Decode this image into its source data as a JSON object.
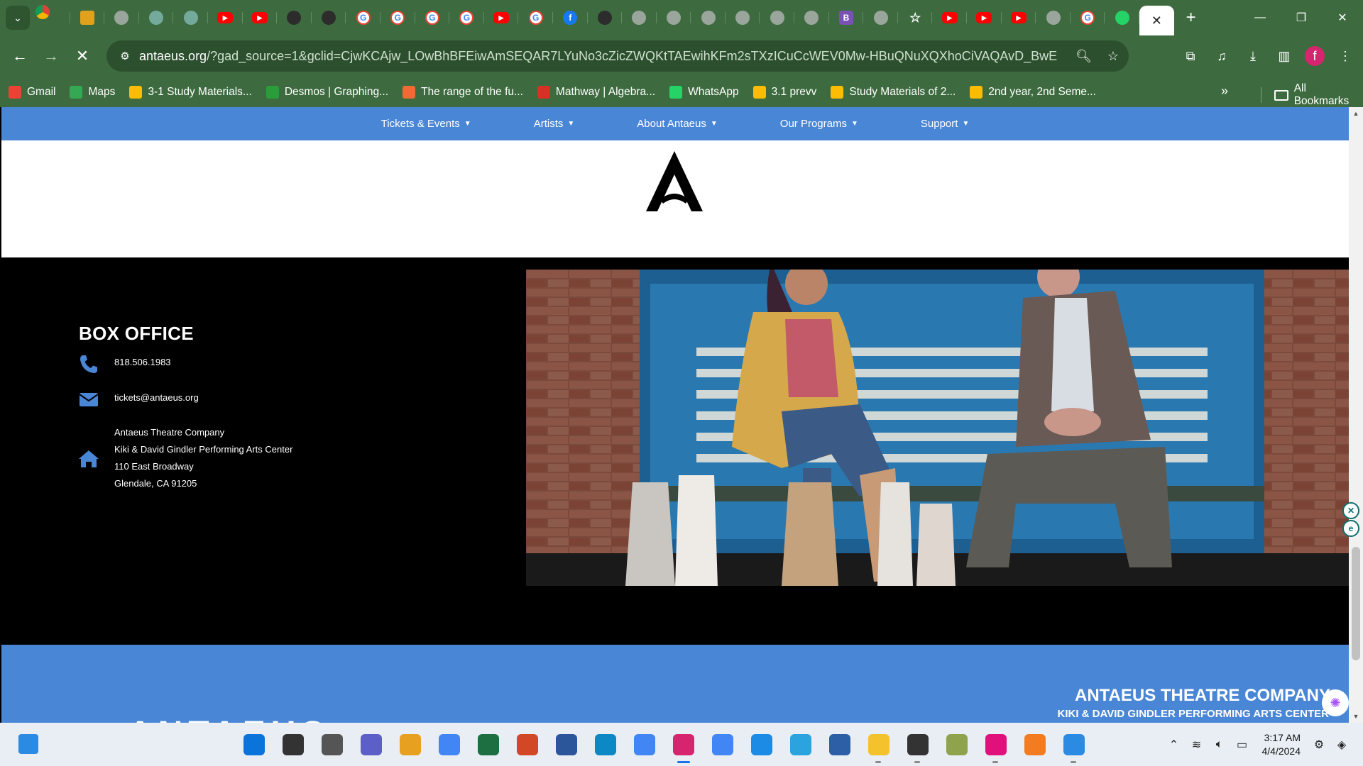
{
  "browser": {
    "tab_search_icon": "chevron-down-icon",
    "tabs": [
      {
        "icon": "chrome-icon",
        "kind": "chrome"
      },
      {
        "icon": "prism-icon",
        "kind": "prism"
      },
      {
        "icon": "globe-icon",
        "kind": "gray"
      },
      {
        "icon": "chatgpt-icon",
        "kind": "gpt"
      },
      {
        "icon": "chatgpt-icon",
        "kind": "gpt"
      },
      {
        "icon": "youtube-icon",
        "kind": "yt"
      },
      {
        "icon": "youtube-icon",
        "kind": "yt"
      },
      {
        "icon": "github-icon",
        "kind": "dark"
      },
      {
        "icon": "github-icon",
        "kind": "dark"
      },
      {
        "icon": "google-icon",
        "kind": "g"
      },
      {
        "icon": "google-icon",
        "kind": "g"
      },
      {
        "icon": "google-icon",
        "kind": "g"
      },
      {
        "icon": "google-icon",
        "kind": "g"
      },
      {
        "icon": "youtube-icon",
        "kind": "yt"
      },
      {
        "icon": "google-icon",
        "kind": "g"
      },
      {
        "icon": "facebook-icon",
        "kind": "fb"
      },
      {
        "icon": "github-icon",
        "kind": "dark"
      },
      {
        "icon": "globe-icon",
        "kind": "gray"
      },
      {
        "icon": "globe-icon",
        "kind": "gray"
      },
      {
        "icon": "globe-icon",
        "kind": "gray"
      },
      {
        "icon": "globe-icon",
        "kind": "gray"
      },
      {
        "icon": "globe-icon",
        "kind": "gray"
      },
      {
        "icon": "globe-icon",
        "kind": "gray"
      },
      {
        "icon": "bootstrap-icon",
        "kind": "bs"
      },
      {
        "icon": "globe-icon",
        "kind": "gray"
      },
      {
        "icon": "star-icon",
        "kind": "star"
      },
      {
        "icon": "youtube-icon",
        "kind": "yt"
      },
      {
        "icon": "youtube-icon",
        "kind": "yt"
      },
      {
        "icon": "youtube-icon",
        "kind": "yt"
      },
      {
        "icon": "globe-icon",
        "kind": "gray"
      },
      {
        "icon": "google-icon",
        "kind": "g"
      },
      {
        "icon": "whatsapp-icon",
        "kind": "wa"
      }
    ],
    "url_domain": "antaeus.org",
    "url_rest": "/?gad_source=1&gclid=CjwKCAjw_LOwBhBFEiwAmSEQAR7LYuNo3cZicZWQKtTAEwihKFm2sTXzICuCcWEV0Mw-HBuQNuXQXhoCiVAQAvD_BwE",
    "profile_initial": "f",
    "bookmarks": [
      {
        "label": "Gmail",
        "color": "#ea4335"
      },
      {
        "label": "Maps",
        "color": "#34a853"
      },
      {
        "label": "3-1 Study Materials...",
        "color": "#fbbc04"
      },
      {
        "label": "Desmos | Graphing...",
        "color": "#2a9d3a"
      },
      {
        "label": "The range of the fu...",
        "color": "#f06a35"
      },
      {
        "label": "Mathway | Algebra...",
        "color": "#d93025"
      },
      {
        "label": "WhatsApp",
        "color": "#25d366"
      },
      {
        "label": "3.1 prevv",
        "color": "#fbbc04"
      },
      {
        "label": "Study Materials of 2...",
        "color": "#fbbc04"
      },
      {
        "label": "2nd year, 2nd Seme...",
        "color": "#fbbc04"
      }
    ],
    "all_bookmarks": "All Bookmarks"
  },
  "site": {
    "nav": [
      {
        "label": "Tickets & Events"
      },
      {
        "label": "Artists"
      },
      {
        "label": "About Antaeus"
      },
      {
        "label": "Our Programs"
      },
      {
        "label": "Support"
      }
    ],
    "box_office": {
      "title": "BOX OFFICE",
      "phone": "818.506.1983",
      "email": "tickets@antaeus.org",
      "address": [
        "Antaeus Theatre Company",
        "Kiki & David Gindler Performing Arts Center",
        "110 East Broadway",
        "Glendale, CA 91205"
      ]
    },
    "footer": {
      "name": "ANTAEUS THEATRE COMPANY",
      "subtitle": "KIKI & DAVID GINDLER PERFORMING ARTS CENTER",
      "logo_text": "ANTAEUS"
    }
  },
  "taskbar": {
    "apps": [
      {
        "icon": "windows-start-icon",
        "color": "#0a74da",
        "running": false
      },
      {
        "icon": "search-icon",
        "color": "#333333",
        "running": false
      },
      {
        "icon": "task-view-icon",
        "color": "#555555",
        "running": false
      },
      {
        "icon": "teams-icon",
        "color": "#5b5fc7",
        "running": false
      },
      {
        "icon": "microsoft-store-icon",
        "color": "#e8a021",
        "running": false
      },
      {
        "icon": "chrome-icon",
        "color": "#4285f4",
        "running": false
      },
      {
        "icon": "excel-icon",
        "color": "#1d6f42",
        "running": false
      },
      {
        "icon": "powerpoint-icon",
        "color": "#d24726",
        "running": false
      },
      {
        "icon": "word-icon",
        "color": "#2b579a",
        "running": false
      },
      {
        "icon": "edge-icon",
        "color": "#0c88c4",
        "running": false
      },
      {
        "icon": "chrome-icon",
        "color": "#4285f4",
        "running": false
      },
      {
        "icon": "chrome-profile-icon",
        "color": "#d6246e",
        "running": true,
        "active": true
      },
      {
        "icon": "chrome-icon",
        "color": "#4285f4",
        "running": false
      },
      {
        "icon": "messenger-icon",
        "color": "#1b8be6",
        "running": false
      },
      {
        "icon": "telegram-icon",
        "color": "#2aa3df",
        "running": false
      },
      {
        "icon": "vscode-icon",
        "color": "#2d5fa6",
        "running": false
      },
      {
        "icon": "file-explorer-icon",
        "color": "#f3c22d",
        "running": true
      },
      {
        "icon": "terminal-icon",
        "color": "#333333",
        "running": true
      },
      {
        "icon": "package-icon",
        "color": "#8ea34b",
        "running": false
      },
      {
        "icon": "intellij-icon",
        "color": "#e0117b",
        "running": true
      },
      {
        "icon": "xampp-icon",
        "color": "#f37b20",
        "running": false
      },
      {
        "icon": "notepad-icon",
        "color": "#2b8ae2",
        "running": true
      }
    ],
    "time": "3:17 AM",
    "date": "4/4/2024"
  }
}
